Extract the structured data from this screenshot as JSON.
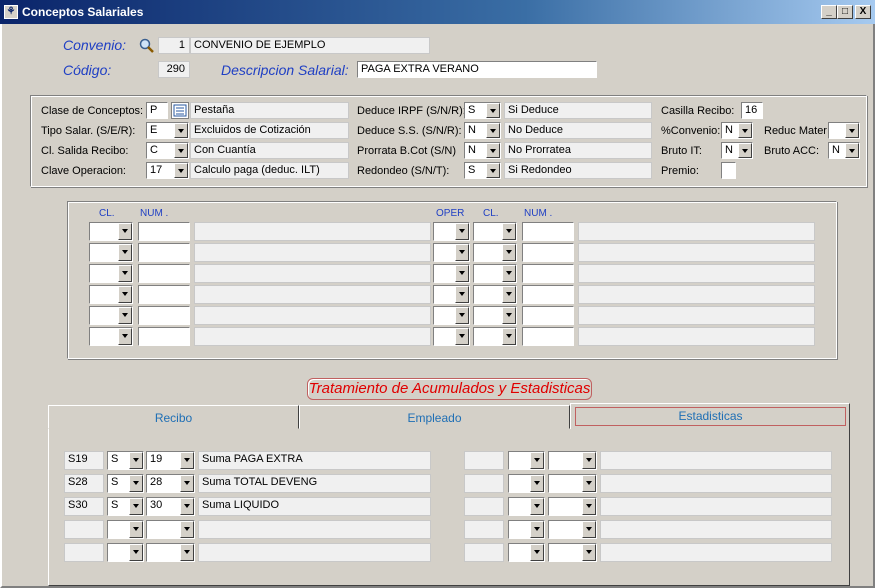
{
  "window": {
    "title": "Conceptos Salariales",
    "icon": "app-icon",
    "controls": [
      "_",
      "□",
      "X"
    ]
  },
  "header": {
    "convenio_label": "Convenio:",
    "convenio_code": "1",
    "convenio_name": "CONVENIO DE EJEMPLO",
    "codigo_label": "Código:",
    "codigo_value": "290",
    "descripcion_label": "Descripcion Salarial:",
    "descripcion_value": "PAGA EXTRA VERANO"
  },
  "props": {
    "clase_label": "Clase de Conceptos:",
    "clase_value": "P",
    "clase_desc": "Pestaña",
    "tipo_label": "Tipo Salar. (S/E/R):",
    "tipo_value": "E",
    "tipo_desc": "Excluidos de Cotización",
    "salida_label": "Cl. Salida Recibo:",
    "salida_value": "C",
    "salida_desc": "Con Cuantía",
    "clave_label": "Clave Operacion:",
    "clave_value": "17",
    "clave_desc": "Calculo paga (deduc. ILT)",
    "irpf_label": "Deduce IRPF (S/N/R):",
    "irpf_value": "S",
    "irpf_desc": "Si Deduce",
    "ss_label": "Deduce S.S. (S/N/R):",
    "ss_value": "N",
    "ss_desc": "No Deduce",
    "prorrata_label": "Prorrata B.Cot (S/N)",
    "prorrata_value": "N",
    "prorrata_desc": "No Prorratea",
    "redondeo_label": "Redondeo (S/N/T):",
    "redondeo_value": "S",
    "redondeo_desc": "Si Redondeo",
    "casilla_label": "Casilla Recibo:",
    "casilla_value": "16",
    "convenio_pct_label": "%Convenio:",
    "convenio_pct_value": "N",
    "bruto_it_label": "Bruto IT:",
    "bruto_it_value": "N",
    "premio_label": "Premio:",
    "reduc_label": "Reduc Mater",
    "reduc_value": "",
    "bruto_acc_label": "Bruto ACC:",
    "bruto_acc_value": "N"
  },
  "formula": {
    "col_cl": "CL.",
    "col_num": "NUM .",
    "col_oper": "OPER",
    "col_cl2": "CL.",
    "col_num2": "NUM ."
  },
  "section_title": "Tratamiento de Acumulados y Estadisticas",
  "tabs": [
    "Recibo",
    "Empleado",
    "Estadisticas"
  ],
  "acumulados": [
    {
      "code": "S19",
      "sel": "S",
      "num": "19",
      "desc": "Suma PAGA EXTRA"
    },
    {
      "code": "S28",
      "sel": "S",
      "num": "28",
      "desc": "Suma TOTAL DEVENG"
    },
    {
      "code": "S30",
      "sel": "S",
      "num": "30",
      "desc": "Suma LIQUIDO"
    },
    {
      "code": "",
      "sel": "",
      "num": "",
      "desc": ""
    },
    {
      "code": "",
      "sel": "",
      "num": "",
      "desc": ""
    }
  ]
}
